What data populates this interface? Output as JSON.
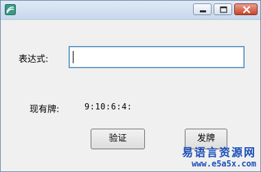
{
  "titlebar": {
    "icons": {
      "app": "app-icon",
      "minimize": "minimize-icon",
      "maximize": "maximize-icon",
      "close": "close-icon"
    }
  },
  "form": {
    "expression_label": "表达式:",
    "expression_value": "",
    "current_cards_label": "现有牌:",
    "current_cards_value": "9:10:6:4:"
  },
  "buttons": {
    "verify": "验证",
    "deal": "发牌"
  },
  "watermark": {
    "title": "易语言资源网",
    "url": "www.e5a5x.com"
  },
  "colors": {
    "window_bg": "#f0f0f0",
    "input_focus_border": "#3c7fb1",
    "close_button": "#c9442b",
    "watermark": "#1a4fb8"
  }
}
